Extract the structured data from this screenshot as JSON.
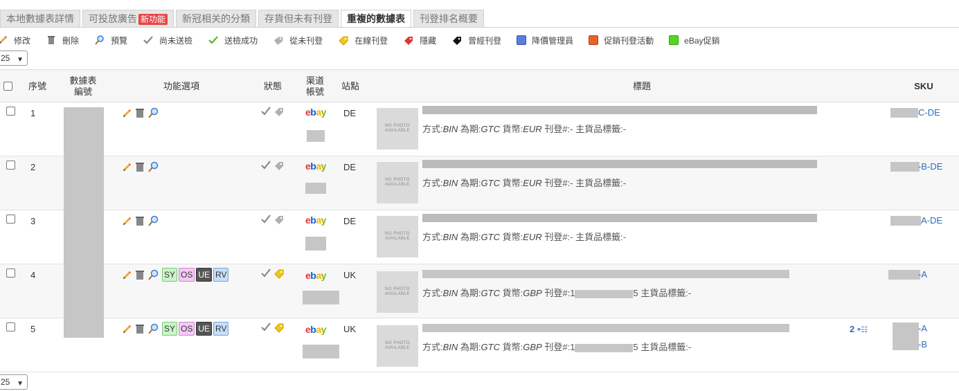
{
  "tabs": [
    {
      "label": "本地數據表詳情"
    },
    {
      "label": "可投放廣告",
      "badge": "新功能"
    },
    {
      "label": "新冠相关的分類"
    },
    {
      "label": "存貨但未有刊登"
    },
    {
      "label": "重複的數據表"
    },
    {
      "label": "刊登排名概要"
    }
  ],
  "legend": [
    {
      "label": "修改",
      "icon": "pencil-icon"
    },
    {
      "label": "刪除",
      "icon": "trash-icon"
    },
    {
      "label": "預覽",
      "icon": "magnifier-icon"
    },
    {
      "label": "尚未送檢",
      "icon": "gray-check-icon"
    },
    {
      "label": "送檢成功",
      "icon": "green-check-icon"
    },
    {
      "label": "從未刊登",
      "icon": "gray-tag-icon"
    },
    {
      "label": "在線刊登",
      "icon": "yellow-tag-icon"
    },
    {
      "label": "隱藏",
      "icon": "red-tag-icon"
    },
    {
      "label": "曾經刊登",
      "icon": "black-tag-icon"
    },
    {
      "label": "降價管理員",
      "icon": "blue-square-icon",
      "color": "#5b7de0"
    },
    {
      "label": "促銷刊登活動",
      "icon": "orange-square-icon",
      "color": "#e8632c"
    },
    {
      "label": "eBay促銷",
      "icon": "green-square-icon",
      "color": "#55d625"
    }
  ],
  "page_size": "25",
  "columns": [
    "序號",
    "數據表\n編號",
    "功能選項",
    "狀態",
    "渠道\n帳號",
    "站點",
    "標題",
    "SKU"
  ],
  "meta_labels": {
    "format": "方式:",
    "duration": "為期:",
    "currency": "貨幣:",
    "listing": "刊登#:",
    "tag": "主貨品標籤:"
  },
  "photo_placeholder": "NO PHOTO AVAILABLE",
  "rows": [
    {
      "seq": "1",
      "flags": [],
      "listing_status": "gray",
      "site": "DE",
      "format": "BIN",
      "duration": "GTC",
      "currency": "EUR",
      "listing": "-",
      "tag": "-",
      "skus": [
        "C-DE"
      ]
    },
    {
      "seq": "2",
      "flags": [],
      "listing_status": "gray",
      "site": "DE",
      "format": "BIN",
      "duration": "GTC",
      "currency": "EUR",
      "listing": "-",
      "tag": "-",
      "skus": [
        "-B-DE"
      ]
    },
    {
      "seq": "3",
      "flags": [],
      "listing_status": "gray",
      "site": "DE",
      "format": "BIN",
      "duration": "GTC",
      "currency": "EUR",
      "listing": "-",
      "tag": "-",
      "skus": [
        "A-DE"
      ]
    },
    {
      "seq": "4",
      "flags": [
        "SY",
        "OS",
        "UE",
        "RV"
      ],
      "listing_status": "yellow",
      "site": "UK",
      "format": "BIN",
      "duration": "GTC",
      "currency": "GBP",
      "listing": "1",
      "listing_tail": "5",
      "tag": "-",
      "skus": [
        "-A"
      ]
    },
    {
      "seq": "5",
      "flags": [
        "SY",
        "OS",
        "UE",
        "RV"
      ],
      "listing_status": "yellow",
      "site": "UK",
      "format": "BIN",
      "duration": "GTC",
      "currency": "GBP",
      "listing": "1",
      "listing_tail": "5",
      "tag": "-",
      "extra_count": "2",
      "skus": [
        "-A",
        "-B"
      ]
    }
  ],
  "ebay_logo": {
    "e": "e",
    "b": "b",
    "a": "a",
    "y": "y"
  }
}
